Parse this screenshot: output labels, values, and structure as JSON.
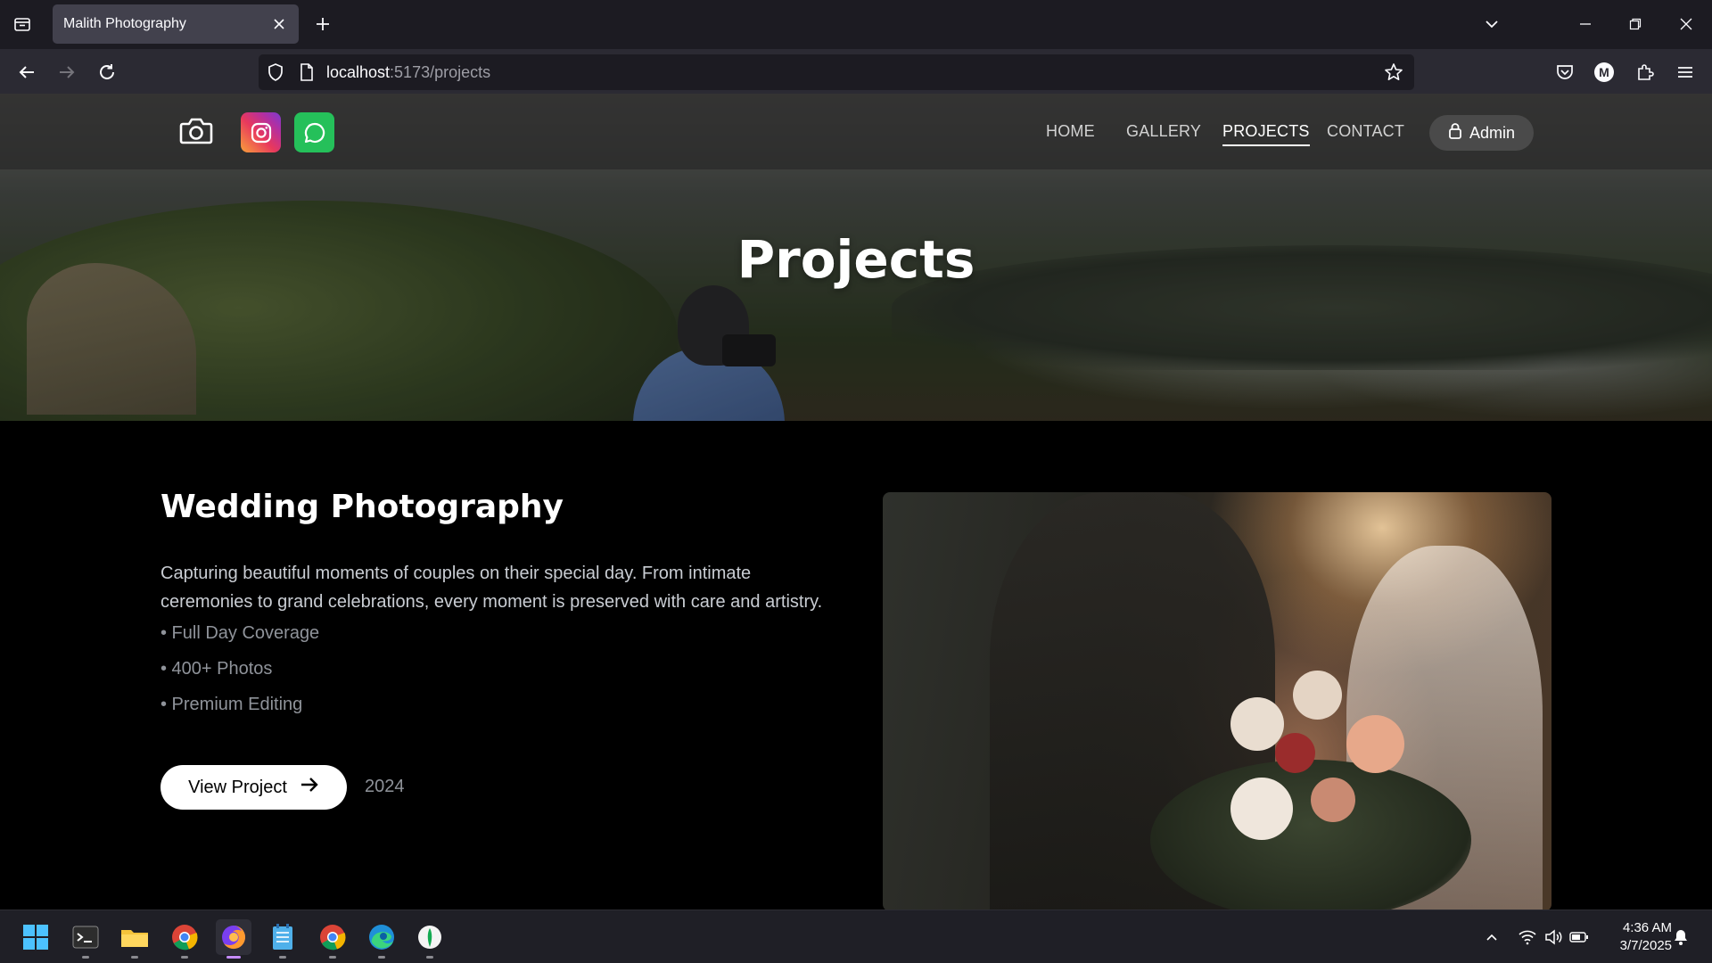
{
  "browser": {
    "tab_title": "Malith Photography",
    "url_host": "localhost",
    "url_rest": ":5173/projects"
  },
  "site": {
    "nav": {
      "home": "HOME",
      "gallery": "GALLERY",
      "projects": "PROJECTS",
      "contact": "CONTACT",
      "active": "PROJECTS"
    },
    "admin_label": "Admin",
    "hero_title": "Projects"
  },
  "project": {
    "title": "Wedding Photography",
    "description": "Capturing beautiful moments of couples on their special day. From intimate ceremonies to grand celebrations, every moment is preserved with care and artistry.",
    "features": [
      "• Full Day Coverage",
      "• 400+ Photos",
      "• Premium Editing"
    ],
    "button_label": "View Project",
    "year": "2024"
  },
  "taskbar": {
    "time": "4:36 AM",
    "date": "3/7/2025",
    "apps": [
      "windows-start",
      "terminal",
      "file-explorer",
      "chrome",
      "firefox",
      "notepad",
      "chrome",
      "edge",
      "mongodb-compass"
    ]
  },
  "colors": {
    "instagram_gradient": [
      "#f9a13a",
      "#e8385d",
      "#b42fa0"
    ],
    "whatsapp": "#25c05a",
    "admin_button": "#4a4a4a",
    "accent_firefox": "#c58cff"
  }
}
